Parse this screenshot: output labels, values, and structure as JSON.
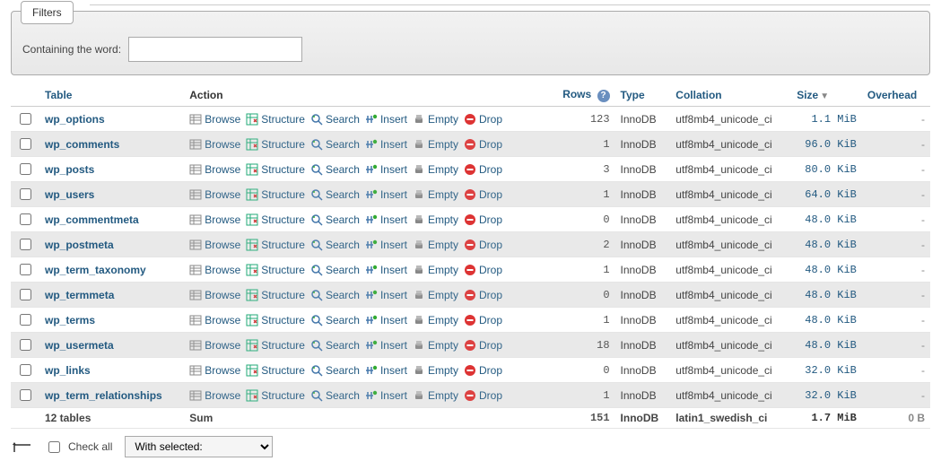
{
  "filters": {
    "tab_label": "Filters",
    "containing_label": "Containing the word:",
    "word_value": ""
  },
  "headers": {
    "table": "Table",
    "action": "Action",
    "rows": "Rows",
    "type": "Type",
    "collation": "Collation",
    "size": "Size",
    "overhead": "Overhead"
  },
  "action_labels": {
    "browse": "Browse",
    "structure": "Structure",
    "search": "Search",
    "insert": "Insert",
    "empty": "Empty",
    "drop": "Drop"
  },
  "tables": [
    {
      "name": "wp_options",
      "rows": "123",
      "type": "InnoDB",
      "collation": "utf8mb4_unicode_ci",
      "size": "1.1 MiB",
      "overhead": "-"
    },
    {
      "name": "wp_comments",
      "rows": "1",
      "type": "InnoDB",
      "collation": "utf8mb4_unicode_ci",
      "size": "96.0 KiB",
      "overhead": "-"
    },
    {
      "name": "wp_posts",
      "rows": "3",
      "type": "InnoDB",
      "collation": "utf8mb4_unicode_ci",
      "size": "80.0 KiB",
      "overhead": "-"
    },
    {
      "name": "wp_users",
      "rows": "1",
      "type": "InnoDB",
      "collation": "utf8mb4_unicode_ci",
      "size": "64.0 KiB",
      "overhead": "-"
    },
    {
      "name": "wp_commentmeta",
      "rows": "0",
      "type": "InnoDB",
      "collation": "utf8mb4_unicode_ci",
      "size": "48.0 KiB",
      "overhead": "-"
    },
    {
      "name": "wp_postmeta",
      "rows": "2",
      "type": "InnoDB",
      "collation": "utf8mb4_unicode_ci",
      "size": "48.0 KiB",
      "overhead": "-"
    },
    {
      "name": "wp_term_taxonomy",
      "rows": "1",
      "type": "InnoDB",
      "collation": "utf8mb4_unicode_ci",
      "size": "48.0 KiB",
      "overhead": "-"
    },
    {
      "name": "wp_termmeta",
      "rows": "0",
      "type": "InnoDB",
      "collation": "utf8mb4_unicode_ci",
      "size": "48.0 KiB",
      "overhead": "-"
    },
    {
      "name": "wp_terms",
      "rows": "1",
      "type": "InnoDB",
      "collation": "utf8mb4_unicode_ci",
      "size": "48.0 KiB",
      "overhead": "-"
    },
    {
      "name": "wp_usermeta",
      "rows": "18",
      "type": "InnoDB",
      "collation": "utf8mb4_unicode_ci",
      "size": "48.0 KiB",
      "overhead": "-"
    },
    {
      "name": "wp_links",
      "rows": "0",
      "type": "InnoDB",
      "collation": "utf8mb4_unicode_ci",
      "size": "32.0 KiB",
      "overhead": "-"
    },
    {
      "name": "wp_term_relationships",
      "rows": "1",
      "type": "InnoDB",
      "collation": "utf8mb4_unicode_ci",
      "size": "32.0 KiB",
      "overhead": "-"
    }
  ],
  "summary": {
    "count_label": "12 tables",
    "sum_label": "Sum",
    "rows": "151",
    "type": "InnoDB",
    "collation": "latin1_swedish_ci",
    "size": "1.7 MiB",
    "overhead": "0 B"
  },
  "footer": {
    "check_all": "Check all",
    "with_selected": "With selected:"
  }
}
